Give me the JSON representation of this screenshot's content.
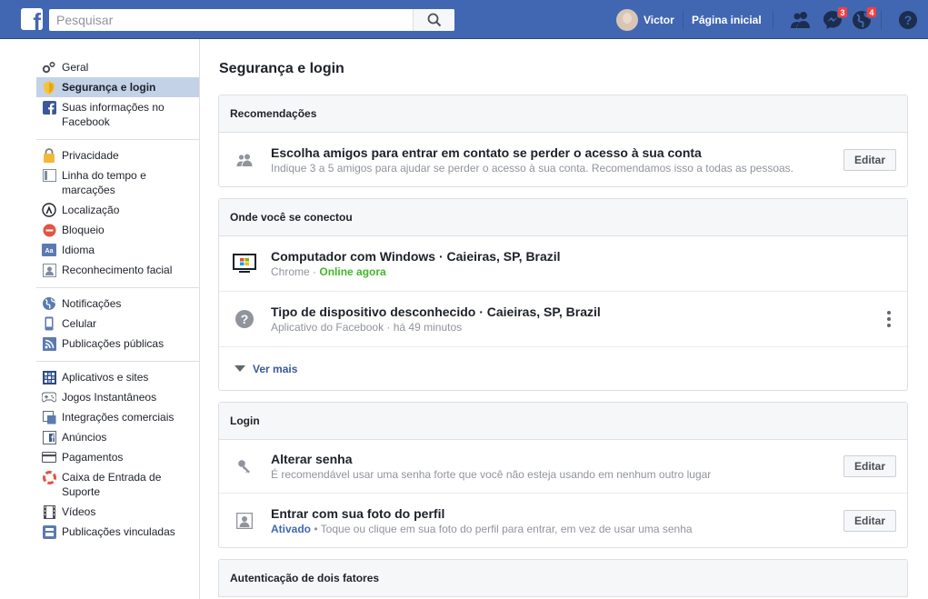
{
  "topbar": {
    "search_placeholder": "Pesquisar",
    "user_name": "Victor",
    "home_label": "Página inicial",
    "messages_count": "3",
    "notifications_count": "4"
  },
  "sidebar": {
    "groups": [
      [
        {
          "label": "Geral",
          "icon": "gears-icon"
        },
        {
          "label": "Segurança e login",
          "icon": "badge-icon",
          "active": true
        },
        {
          "label": "Suas informações no Facebook",
          "icon": "facebook-icon"
        }
      ],
      [
        {
          "label": "Privacidade",
          "icon": "lock-icon"
        },
        {
          "label": "Linha do tempo e marcações",
          "icon": "timeline-icon"
        },
        {
          "label": "Localização",
          "icon": "location-icon"
        },
        {
          "label": "Bloqueio",
          "icon": "block-icon"
        },
        {
          "label": "Idioma",
          "icon": "language-icon"
        },
        {
          "label": "Reconhecimento facial",
          "icon": "face-icon"
        }
      ],
      [
        {
          "label": "Notificações",
          "icon": "globe-icon"
        },
        {
          "label": "Celular",
          "icon": "mobile-icon"
        },
        {
          "label": "Publicações públicas",
          "icon": "rss-icon"
        }
      ],
      [
        {
          "label": "Aplicativos e sites",
          "icon": "apps-icon"
        },
        {
          "label": "Jogos Instantâneos",
          "icon": "gamepad-icon"
        },
        {
          "label": "Integrações comerciais",
          "icon": "integrations-icon"
        },
        {
          "label": "Anúncios",
          "icon": "ads-icon"
        },
        {
          "label": "Pagamentos",
          "icon": "card-icon"
        },
        {
          "label": "Caixa de Entrada de Suporte",
          "icon": "lifebuoy-icon"
        },
        {
          "label": "Vídeos",
          "icon": "film-icon"
        },
        {
          "label": "Publicações vinculadas",
          "icon": "linked-posts-icon"
        }
      ]
    ]
  },
  "main": {
    "title": "Segurança e login",
    "recommendations": {
      "heading": "Recomendações",
      "item_title": "Escolha amigos para entrar em contato se perder o acesso à sua conta",
      "item_sub": "Indique 3 a 5 amigos para ajudar se perder o acesso à sua conta. Recomendamos isso a todas as pessoas.",
      "button": "Editar"
    },
    "where_logged": {
      "heading": "Onde você se conectou",
      "sessions": [
        {
          "title": "Computador com Windows · Caieiras, SP, Brazil",
          "app": "Chrome",
          "sep": " · ",
          "status": "Online agora"
        },
        {
          "title": "Tipo de dispositivo desconhecido · Caieiras, SP, Brazil",
          "app": "Aplicativo do Facebook",
          "sep": " · ",
          "status": "há 49 minutos"
        }
      ],
      "see_more": "Ver mais"
    },
    "login": {
      "heading": "Login",
      "change_password_title": "Alterar senha",
      "change_password_sub": "É recomendável usar uma senha forte que você não esteja usando em nenhum outro lugar",
      "profile_photo_title": "Entrar com sua foto do perfil",
      "profile_photo_status": "Ativado",
      "profile_photo_sub": " • Toque ou clique em sua foto do perfil para entrar, em vez de usar uma senha",
      "button": "Editar"
    },
    "two_factor": {
      "heading": "Autenticação de dois fatores"
    }
  }
}
